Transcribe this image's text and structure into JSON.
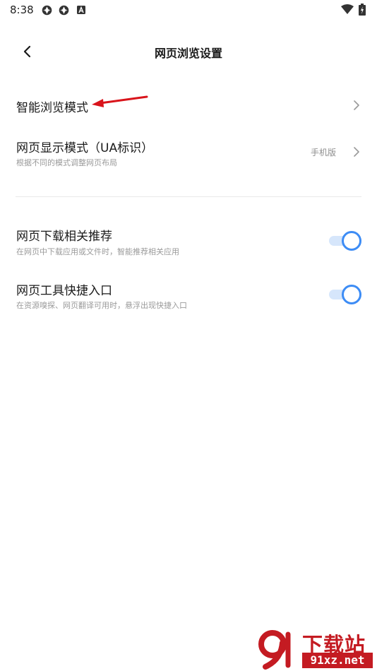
{
  "status_bar": {
    "time": "8:38",
    "icons": [
      "app-notification-icon",
      "app-notification-icon",
      "a-letter-icon",
      "wifi-icon",
      "battery-charging-icon"
    ]
  },
  "header": {
    "title": "网页浏览设置",
    "back_icon": "chevron-left-icon"
  },
  "settings": {
    "smart_browse": {
      "title": "智能浏览模式"
    },
    "display_mode": {
      "title": "网页显示模式（UA标识）",
      "subtitle": "根据不同的模式调整网页布局",
      "value": "手机版"
    },
    "download_recommend": {
      "title": "网页下载相关推荐",
      "subtitle": "在网页中下载应用或文件时，智能推荐相关应用",
      "enabled": true
    },
    "tool_shortcut": {
      "title": "网页工具快捷入口",
      "subtitle": "在资源嗅探、网页翻译可用时，悬浮出现快捷入口",
      "enabled": true
    }
  },
  "watermark": {
    "title": "下载站",
    "domain": "91xz.net"
  },
  "colors": {
    "accent": "#3d8cf5",
    "toggle_track": "#d6e6fb",
    "annotation": "#d9141b",
    "watermark": "#c41b22"
  }
}
